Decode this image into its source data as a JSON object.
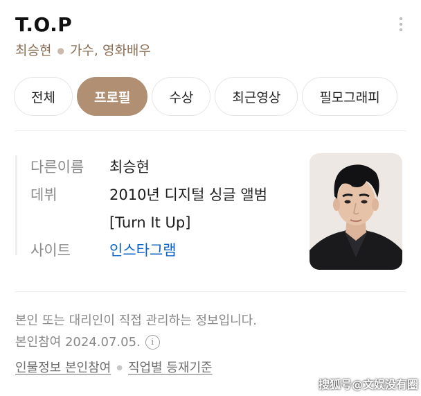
{
  "header": {
    "name": "T.O.P",
    "real_name": "최승현",
    "roles": "가수, 영화배우"
  },
  "tabs": [
    {
      "label": "전체",
      "active": false
    },
    {
      "label": "프로필",
      "active": true
    },
    {
      "label": "수상",
      "active": false
    },
    {
      "label": "최근영상",
      "active": false
    },
    {
      "label": "필모그래피",
      "active": false
    }
  ],
  "profile": {
    "rows": [
      {
        "label": "다른이름",
        "value": "최승현"
      },
      {
        "label": "데뷔",
        "value_line1": "2010년 디지털 싱글 앨범",
        "value_line2": "[Turn It Up]"
      },
      {
        "label": "사이트",
        "value": "인스타그램"
      }
    ]
  },
  "footer": {
    "notice": "본인 또는 대리인이 직접 관리하는 정보입니다.",
    "verified": "본인참여 2024.07.05.",
    "info_icon_glyph": "i",
    "link1": "인물정보 본인참여",
    "link2": "직업별 등재기준"
  },
  "watermark": "搜狐号@文娱没有圈",
  "colors": {
    "accent": "#b08f73",
    "subtitle": "#8b6f55",
    "link": "#0b62c4"
  },
  "icons": {
    "more": "more-vertical-icon",
    "info": "info-circle-icon"
  }
}
